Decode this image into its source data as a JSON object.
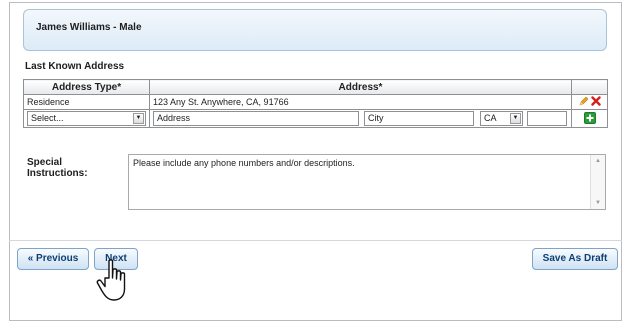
{
  "person": {
    "header": "James Williams - Male"
  },
  "address_section": {
    "title": "Last Known Address",
    "columns": [
      "Address Type*",
      "Address*"
    ],
    "rows": [
      {
        "type": "Residence",
        "address": "123 Any St. Anywhere, CA, 91766"
      }
    ],
    "new_row": {
      "type_select": "Select...",
      "address_placeholder": "Address",
      "city_placeholder": "City",
      "state_value": "CA",
      "zip_value": ""
    }
  },
  "special_instructions": {
    "label_line1": "Special",
    "label_line2": "Instructions:",
    "placeholder": "Please include any phone numbers and/or descriptions."
  },
  "nav": {
    "previous_label": "« Previous",
    "next_label": "Next",
    "save_draft_label": "Save As Draft"
  },
  "icons": {
    "edit": "pencil-icon",
    "delete": "delete-x-icon",
    "add": "add-plus-icon",
    "cursor": "hand-pointer-icon",
    "dropdown": "chevron-down-icon"
  },
  "colors": {
    "header_bg": "#dcebf7",
    "button_text": "#0f3f72",
    "delete_red": "#d21f1f",
    "add_green": "#2a9d3a",
    "edit_orange": "#e8a21c"
  }
}
